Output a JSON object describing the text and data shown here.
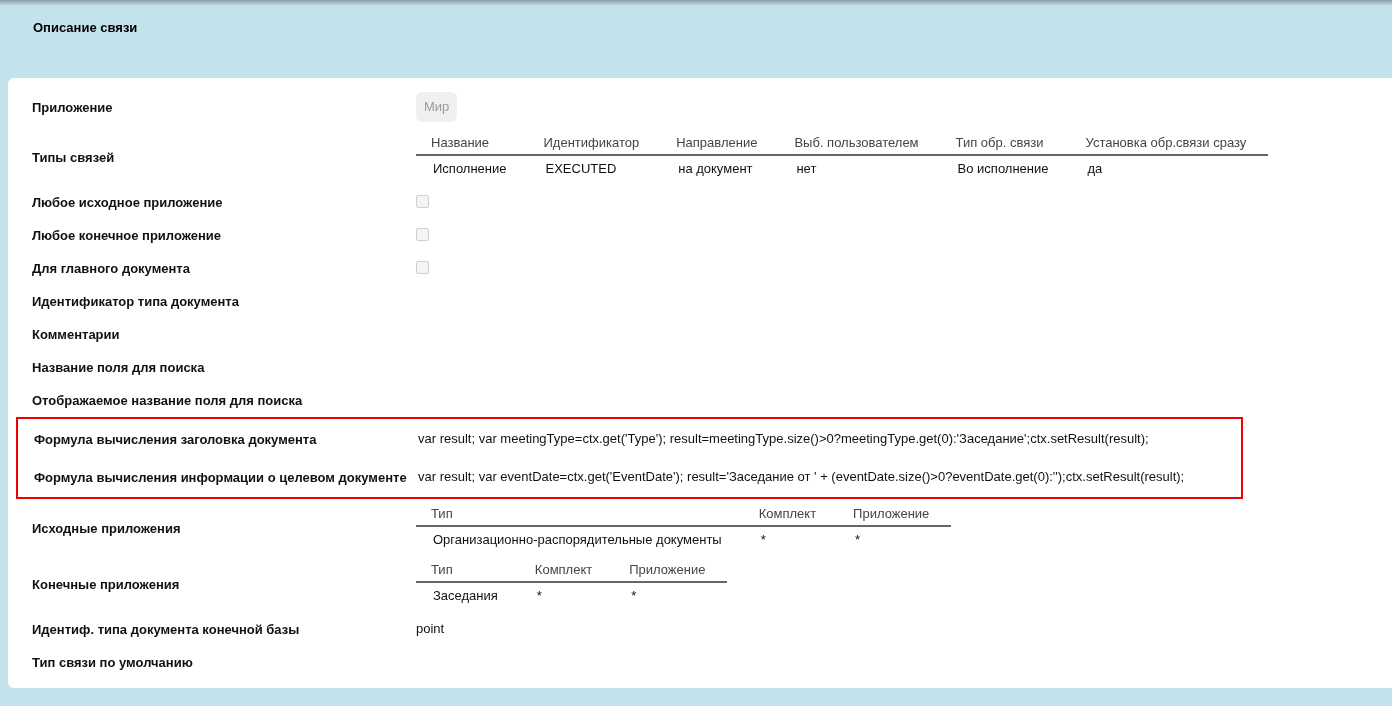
{
  "title": "Описание связи",
  "rows": [
    {
      "kind": "field",
      "label": "Приложение",
      "value": "Мир",
      "highlighted": false
    },
    {
      "kind": "table",
      "label": "Типы связей",
      "highlighted": false,
      "columns": [
        "Название",
        "Идентификатор",
        "Направление",
        "Выб. пользователем",
        "Тип обр. связи",
        "Установка обр.связи сразу"
      ],
      "rows": [
        [
          "Исполнение",
          "EXECUTED",
          "на документ",
          "нет",
          "Во исполнение",
          "да"
        ]
      ]
    },
    {
      "kind": "checkbox",
      "label": "Любое исходное приложение",
      "checked": false,
      "highlighted": false
    },
    {
      "kind": "checkbox",
      "label": "Любое конечное приложение",
      "checked": false,
      "highlighted": false
    },
    {
      "kind": "checkbox",
      "label": "Для главного документа",
      "checked": false,
      "highlighted": false
    },
    {
      "kind": "text",
      "label": "Идентификатор типа документа",
      "highlighted": false
    },
    {
      "kind": "text",
      "label": "Комментарии",
      "highlighted": false
    },
    {
      "kind": "text",
      "label": "Название поля для поиска",
      "highlighted": false
    },
    {
      "kind": "text",
      "label": "Отображаемое название поля для поиска",
      "highlighted": false
    },
    {
      "kind": "text",
      "label": "Формула вычисления заголовка документа",
      "value": "var result; var meetingType=ctx.get('Type'); result=meetingType.size()>0?meetingType.get(0):'Заседание';ctx.setResult(result);",
      "highlighted": true
    },
    {
      "kind": "text",
      "label": "Формула вычисления информации о целевом документе",
      "value": "var result; var eventDate=ctx.get('EventDate'); result='Заседание от ' + (eventDate.size()>0?eventDate.get(0):'');ctx.setResult(result);",
      "highlighted": true
    },
    {
      "kind": "table",
      "label": "Исходные приложения",
      "highlighted": false,
      "columns": [
        "Тип",
        "Комплект",
        "Приложение"
      ],
      "rows": [
        [
          "Организационно-распорядительные документы",
          "*",
          "*"
        ]
      ]
    },
    {
      "kind": "table",
      "label": "Конечные приложения",
      "highlighted": false,
      "columns": [
        "Тип",
        "Комплект",
        "Приложение"
      ],
      "rows": [
        [
          "Заседания",
          "*",
          "*"
        ]
      ]
    },
    {
      "kind": "text",
      "label": "Идентиф. типа документа конечной базы",
      "value": "point",
      "highlighted": false
    },
    {
      "kind": "text",
      "label": "Тип связи по умолчанию",
      "highlighted": false
    }
  ]
}
